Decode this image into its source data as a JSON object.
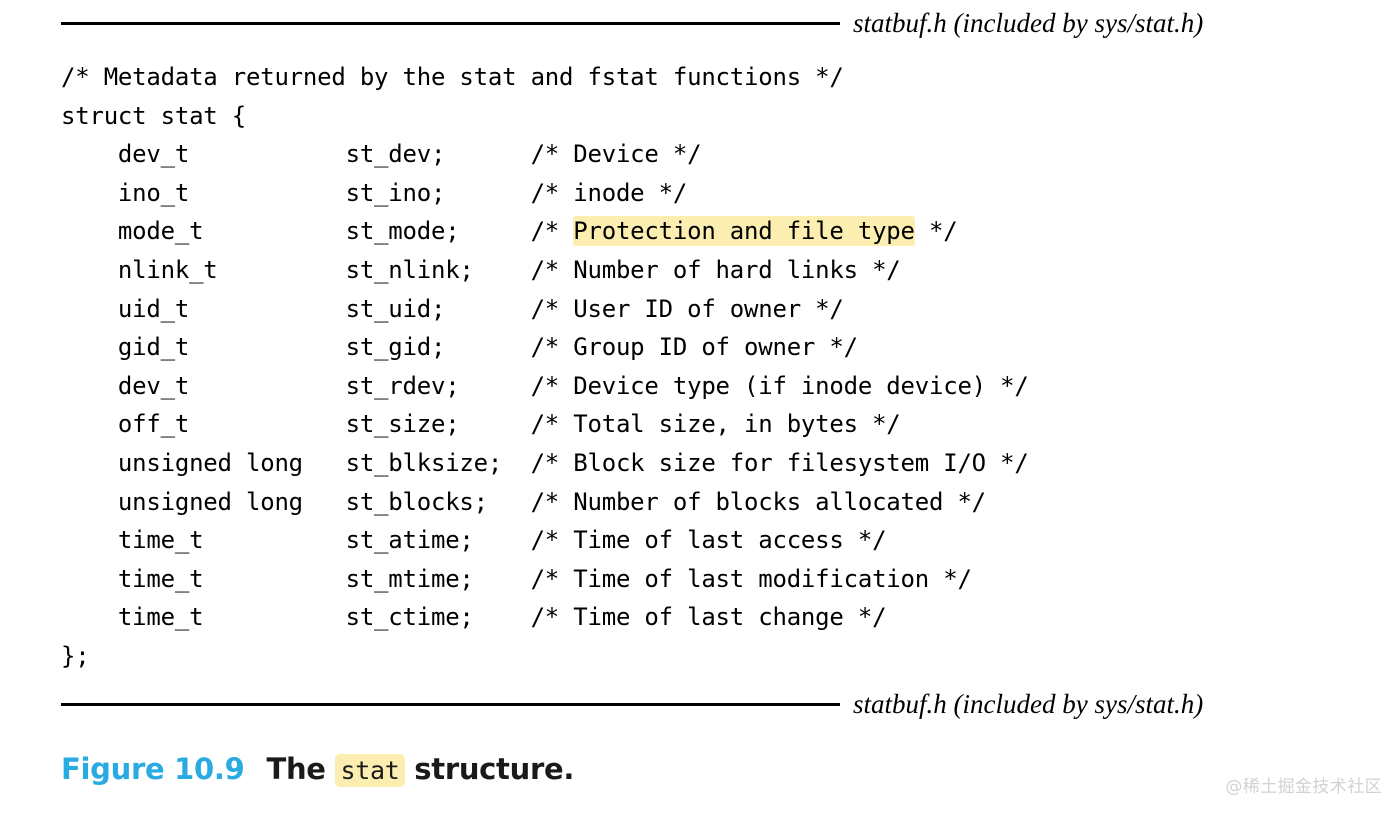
{
  "figure": {
    "source_label": "statbuf.h (included by sys/stat.h)",
    "caption_number": "Figure 10.9",
    "caption_prefix": "The ",
    "caption_code": "stat",
    "caption_suffix": " structure.",
    "watermark": "@稀土掘金技术社区",
    "accent_color": "#29abe2",
    "highlight_color": "#fceeb0",
    "rule_color": "#000000",
    "text_color": "#000000"
  },
  "code": {
    "language": "c",
    "lines": [
      {
        "segments": [
          {
            "text": "/* Metadata returned by the stat and fstat functions */",
            "highlight": false
          }
        ]
      },
      {
        "segments": [
          {
            "text": "struct stat {",
            "highlight": false
          }
        ]
      },
      {
        "segments": [
          {
            "text": "    dev_t           st_dev;      /* Device */",
            "highlight": false
          }
        ]
      },
      {
        "segments": [
          {
            "text": "    ino_t           st_ino;      /* inode */",
            "highlight": false
          }
        ]
      },
      {
        "segments": [
          {
            "text": "    mode_t          st_mode;     /* ",
            "highlight": false
          },
          {
            "text": "Protection and file type",
            "highlight": true
          },
          {
            "text": " */",
            "highlight": false
          }
        ]
      },
      {
        "segments": [
          {
            "text": "    nlink_t         st_nlink;    /* Number of hard links */",
            "highlight": false
          }
        ]
      },
      {
        "segments": [
          {
            "text": "    uid_t           st_uid;      /* User ID of owner */",
            "highlight": false
          }
        ]
      },
      {
        "segments": [
          {
            "text": "    gid_t           st_gid;      /* Group ID of owner */",
            "highlight": false
          }
        ]
      },
      {
        "segments": [
          {
            "text": "    dev_t           st_rdev;     /* Device type (if inode device) */",
            "highlight": false
          }
        ]
      },
      {
        "segments": [
          {
            "text": "    off_t           st_size;     /* Total size, in bytes */",
            "highlight": false
          }
        ]
      },
      {
        "segments": [
          {
            "text": "    unsigned long   st_blksize;  /* Block size for filesystem I/O */",
            "highlight": false
          }
        ]
      },
      {
        "segments": [
          {
            "text": "    unsigned long   st_blocks;   /* Number of blocks allocated */",
            "highlight": false
          }
        ]
      },
      {
        "segments": [
          {
            "text": "    time_t          st_atime;    /* Time of last access */",
            "highlight": false
          }
        ]
      },
      {
        "segments": [
          {
            "text": "    time_t          st_mtime;    /* Time of last modification */",
            "highlight": false
          }
        ]
      },
      {
        "segments": [
          {
            "text": "    time_t          st_ctime;    /* Time of last change */",
            "highlight": false
          }
        ]
      },
      {
        "segments": [
          {
            "text": "};",
            "highlight": false
          }
        ]
      }
    ],
    "fields": [
      {
        "type": "dev_t",
        "name": "st_dev",
        "comment": "Device"
      },
      {
        "type": "ino_t",
        "name": "st_ino",
        "comment": "inode"
      },
      {
        "type": "mode_t",
        "name": "st_mode",
        "comment": "Protection and file type"
      },
      {
        "type": "nlink_t",
        "name": "st_nlink",
        "comment": "Number of hard links"
      },
      {
        "type": "uid_t",
        "name": "st_uid",
        "comment": "User ID of owner"
      },
      {
        "type": "gid_t",
        "name": "st_gid",
        "comment": "Group ID of owner"
      },
      {
        "type": "dev_t",
        "name": "st_rdev",
        "comment": "Device type (if inode device)"
      },
      {
        "type": "off_t",
        "name": "st_size",
        "comment": "Total size, in bytes"
      },
      {
        "type": "unsigned long",
        "name": "st_blksize",
        "comment": "Block size for filesystem I/O"
      },
      {
        "type": "unsigned long",
        "name": "st_blocks",
        "comment": "Number of blocks allocated"
      },
      {
        "type": "time_t",
        "name": "st_atime",
        "comment": "Time of last access"
      },
      {
        "type": "time_t",
        "name": "st_mtime",
        "comment": "Time of last modification"
      },
      {
        "type": "time_t",
        "name": "st_ctime",
        "comment": "Time of last change"
      }
    ]
  }
}
